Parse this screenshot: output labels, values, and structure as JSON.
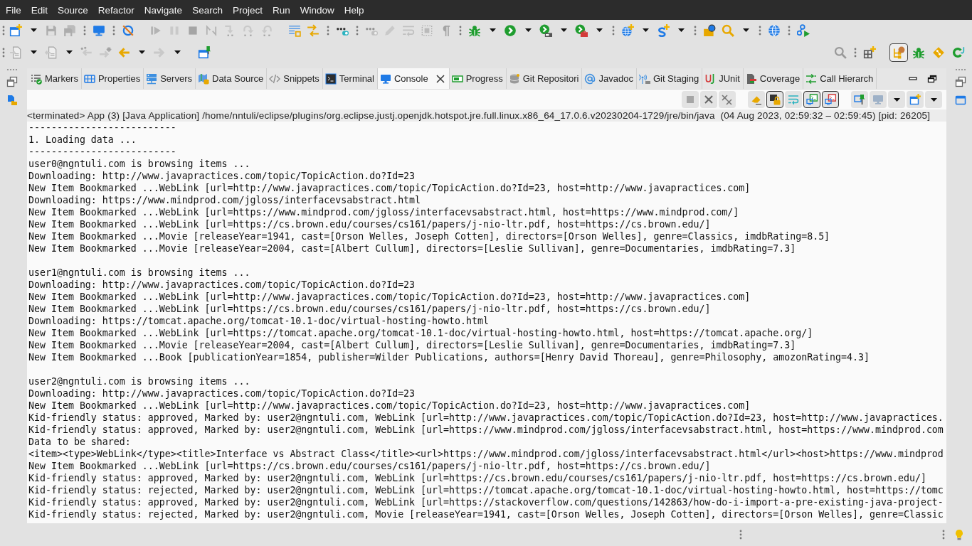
{
  "menu_bar": {
    "items": [
      "File",
      "Edit",
      "Source",
      "Refactor",
      "Navigate",
      "Search",
      "Project",
      "Run",
      "Window",
      "Help"
    ]
  },
  "main_toolbar": {
    "groups": [
      {
        "grip": true,
        "items": [
          {
            "kind": "split",
            "disabled": false
          },
          {
            "kind": "button",
            "disabled": true
          },
          {
            "kind": "button",
            "disabled": true
          }
        ]
      },
      {
        "grip": true,
        "items": [
          {
            "kind": "button",
            "disabled": false
          }
        ]
      },
      {
        "grip": true,
        "items": [
          {
            "kind": "button",
            "disabled": false
          }
        ]
      },
      {
        "grip": false,
        "items": [
          {
            "kind": "button",
            "disabled": true
          },
          {
            "kind": "button",
            "disabled": true
          },
          {
            "kind": "button",
            "disabled": true
          },
          {
            "kind": "button",
            "disabled": true
          },
          {
            "kind": "button",
            "disabled": true
          },
          {
            "kind": "button",
            "disabled": true
          },
          {
            "kind": "button",
            "disabled": true
          }
        ]
      },
      {
        "grip": false,
        "items": [
          {
            "kind": "button",
            "disabled": false
          },
          {
            "kind": "button",
            "disabled": false
          }
        ]
      },
      {
        "grip": true,
        "items": [
          {
            "kind": "button",
            "disabled": false
          }
        ]
      },
      {
        "grip": true,
        "items": [
          {
            "kind": "button",
            "disabled": true
          },
          {
            "kind": "button",
            "disabled": true
          },
          {
            "kind": "button",
            "disabled": true
          },
          {
            "kind": "button",
            "disabled": true
          },
          {
            "kind": "button",
            "disabled": true
          }
        ]
      },
      {
        "grip": true,
        "items": [
          {
            "kind": "split",
            "disabled": false
          },
          {
            "kind": "split",
            "disabled": false
          },
          {
            "kind": "split",
            "disabled": false
          },
          {
            "kind": "split",
            "disabled": false
          }
        ]
      },
      {
        "grip": true,
        "items": [
          {
            "kind": "split",
            "disabled": false
          },
          {
            "kind": "split",
            "disabled": false
          }
        ]
      },
      {
        "grip": true,
        "items": [
          {
            "kind": "button",
            "disabled": false
          },
          {
            "kind": "split",
            "disabled": false
          }
        ]
      },
      {
        "grip": true,
        "items": [
          {
            "kind": "button",
            "disabled": false
          }
        ]
      },
      {
        "grip": true,
        "items": [
          {
            "kind": "button",
            "disabled": false
          }
        ]
      }
    ]
  },
  "navigation_toolbar": {
    "groups": [
      {
        "grip": true,
        "items": [
          {
            "kind": "split",
            "disabled": true
          },
          {
            "kind": "split",
            "disabled": true
          },
          {
            "kind": "button",
            "disabled": true
          },
          {
            "kind": "button",
            "disabled": true
          },
          {
            "kind": "split",
            "disabled": false
          },
          {
            "kind": "split",
            "disabled": true
          }
        ]
      },
      {
        "grip": false,
        "items": [
          {
            "kind": "button",
            "disabled": false
          }
        ]
      }
    ]
  },
  "perspective_switcher": {
    "perspectives": [
      {
        "selected": true
      },
      {
        "selected": false
      },
      {
        "selected": false
      },
      {
        "selected": false
      }
    ]
  },
  "views": {
    "tabs": [
      {
        "label": "Markers",
        "selected": false
      },
      {
        "label": "Properties",
        "selected": false
      },
      {
        "label": "Servers",
        "selected": false
      },
      {
        "label": "Data Source",
        "selected": false
      },
      {
        "label": "Snippets",
        "selected": false
      },
      {
        "label": "Terminal",
        "selected": false
      },
      {
        "label": "Console",
        "selected": true
      },
      {
        "label": "Progress",
        "selected": false
      },
      {
        "label": "Git Repositori",
        "selected": false
      },
      {
        "label": "Javadoc",
        "selected": false
      },
      {
        "label": "Git Staging",
        "selected": false
      },
      {
        "label": "JUnit",
        "selected": false
      },
      {
        "label": "Coverage",
        "selected": false
      },
      {
        "label": "Call Hierarch",
        "selected": false
      }
    ]
  },
  "console": {
    "toolbar": {
      "groups": [
        {
          "items": [
            {
              "kind": "button",
              "pressed": false,
              "disabled": true
            },
            {
              "kind": "button",
              "pressed": false,
              "disabled": false
            },
            {
              "kind": "button",
              "pressed": false,
              "disabled": false
            }
          ]
        },
        {
          "items": [
            {
              "kind": "button",
              "pressed": false,
              "disabled": false
            },
            {
              "kind": "button",
              "pressed": true,
              "disabled": false
            },
            {
              "kind": "button",
              "pressed": false,
              "disabled": false
            },
            {
              "kind": "button",
              "pressed": true,
              "disabled": false
            },
            {
              "kind": "button",
              "pressed": true,
              "disabled": false
            }
          ]
        },
        {
          "items": [
            {
              "kind": "button",
              "pressed": false,
              "disabled": false
            },
            {
              "kind": "split",
              "pressed": false,
              "disabled": true
            },
            {
              "kind": "split",
              "pressed": false,
              "disabled": false
            }
          ]
        }
      ]
    },
    "header": "<terminated> App (3) [Java Application] /home/nntuli/eclipse/plugins/org.eclipse.justj.openjdk.hotspot.jre.full.linux.x86_64_17.0.6.v20230204-1729/jre/bin/java  (04 Aug 2023, 02:59:32 – 02:59:45) [pid: 26205]",
    "blocks": [
      [
        "--------------------------",
        "1. Loading data ...",
        "--------------------------",
        "user0@ngntuli.com is browsing items ...",
        "Downloading: http://www.javapractices.com/topic/TopicAction.do?Id=23",
        "New Item Bookmarked ...WebLink [url=http://www.javapractices.com/topic/TopicAction.do?Id=23, host=http://www.javapractices.com]",
        "Downloading: https://www.mindprod.com/jgloss/interfacevsabstract.html",
        "New Item Bookmarked ...WebLink [url=https://www.mindprod.com/jgloss/interfacevsabstract.html, host=https://www.mindprod.com/]",
        "New Item Bookmarked ...WebLink [url=https://cs.brown.edu/courses/cs161/papers/j-nio-ltr.pdf, host=https://cs.brown.edu/]",
        "New Item Bookmarked ...Movie [releaseYear=1941, cast=[Orson Welles, Joseph Cotten], directors=[Orson Welles], genre=Classics, imdbRating=8.5]",
        "New Item Bookmarked ...Movie [releaseYear=2004, cast=[Albert Cullum], directors=[Leslie Sullivan], genre=Documentaries, imdbRating=7.3]"
      ],
      [
        "user1@ngntuli.com is browsing items ...",
        "Downloading: http://www.javapractices.com/topic/TopicAction.do?Id=23",
        "New Item Bookmarked ...WebLink [url=http://www.javapractices.com/topic/TopicAction.do?Id=23, host=http://www.javapractices.com]",
        "New Item Bookmarked ...WebLink [url=https://cs.brown.edu/courses/cs161/papers/j-nio-ltr.pdf, host=https://cs.brown.edu/]",
        "Downloading: https://tomcat.apache.org/tomcat-10.1-doc/virtual-hosting-howto.html",
        "New Item Bookmarked ...WebLink [url=https://tomcat.apache.org/tomcat-10.1-doc/virtual-hosting-howto.html, host=https://tomcat.apache.org/]",
        "New Item Bookmarked ...Movie [releaseYear=2004, cast=[Albert Cullum], directors=[Leslie Sullivan], genre=Documentaries, imdbRating=7.3]",
        "New Item Bookmarked ...Book [publicationYear=1854, publisher=Wilder Publications, authors=[Henry David Thoreau], genre=Philosophy, amozonRating=4.3]"
      ],
      [
        "user2@ngntuli.com is browsing items ...",
        "Downloading: http://www.javapractices.com/topic/TopicAction.do?Id=23",
        "New Item Bookmarked ...WebLink [url=http://www.javapractices.com/topic/TopicAction.do?Id=23, host=http://www.javapractices.com]",
        "Kid-friendly status: approved, Marked by: user2@ngntuli.com, WebLink [url=http://www.javapractices.com/topic/TopicAction.do?Id=23, host=http://www.javapractices.",
        "Kid-friendly status: approved, Marked by: user2@ngntuli.com, WebLink [url=https://www.mindprod.com/jgloss/interfacevsabstract.html, host=https://www.mindprod.com",
        "Data to be shared:",
        "<item><type>WebLink</type><title>Interface vs Abstract Class</title><url>https://www.mindprod.com/jgloss/interfacevsabstract.html</url><host>https://www.mindprod",
        "New Item Bookmarked ...WebLink [url=https://cs.brown.edu/courses/cs161/papers/j-nio-ltr.pdf, host=https://cs.brown.edu/]",
        "Kid-friendly status: approved, Marked by: user2@ngntuli.com, WebLink [url=https://cs.brown.edu/courses/cs161/papers/j-nio-ltr.pdf, host=https://cs.brown.edu/]",
        "Kid-friendly status: rejected, Marked by: user2@ngntuli.com, WebLink [url=https://tomcat.apache.org/tomcat-10.1-doc/virtual-hosting-howto.html, host=https://tomc",
        "Kid-friendly status: approved, Marked by: user2@ngntuli.com, WebLink [url=https://stackoverflow.com/questions/142863/how-do-i-import-a-pre-existing-java-project-",
        "Kid-friendly status: rejected, Marked by: user2@ngntuli.com, Movie [releaseYear=1941, cast=[Orson Welles, Joseph Cotten], directors=[Orson Welles], genre=Classic"
      ]
    ]
  }
}
